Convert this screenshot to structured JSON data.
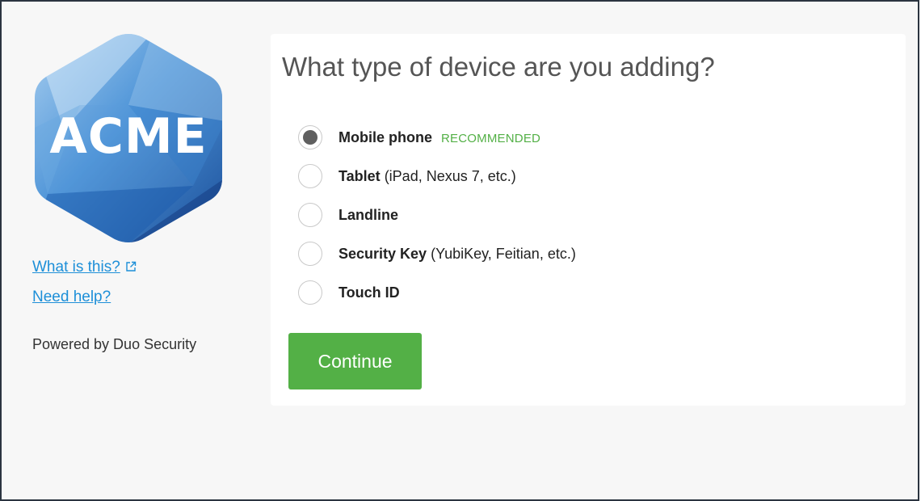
{
  "branding": {
    "logo_text": "ACME",
    "powered_by": "Powered by Duo Security"
  },
  "links": {
    "what_is_this": "What is this?",
    "need_help": "Need help?"
  },
  "form": {
    "title": "What type of device are you adding?",
    "options": [
      {
        "name": "Mobile phone",
        "hint": "",
        "badge": "RECOMMENDED",
        "checked": true
      },
      {
        "name": "Tablet",
        "hint": "(iPad, Nexus 7, etc.)",
        "badge": "",
        "checked": false
      },
      {
        "name": "Landline",
        "hint": "",
        "badge": "",
        "checked": false
      },
      {
        "name": "Security Key",
        "hint": "(YubiKey, Feitian, etc.)",
        "badge": "",
        "checked": false
      },
      {
        "name": "Touch ID",
        "hint": "",
        "badge": "",
        "checked": false
      }
    ],
    "continue_label": "Continue"
  },
  "colors": {
    "accent_green": "#53b046",
    "link_blue": "#1d8fd8",
    "radio_checked": "#5f5f5f",
    "logo_blue": "#2f7fcb"
  },
  "icons": {
    "external_link": "external-link-icon"
  }
}
